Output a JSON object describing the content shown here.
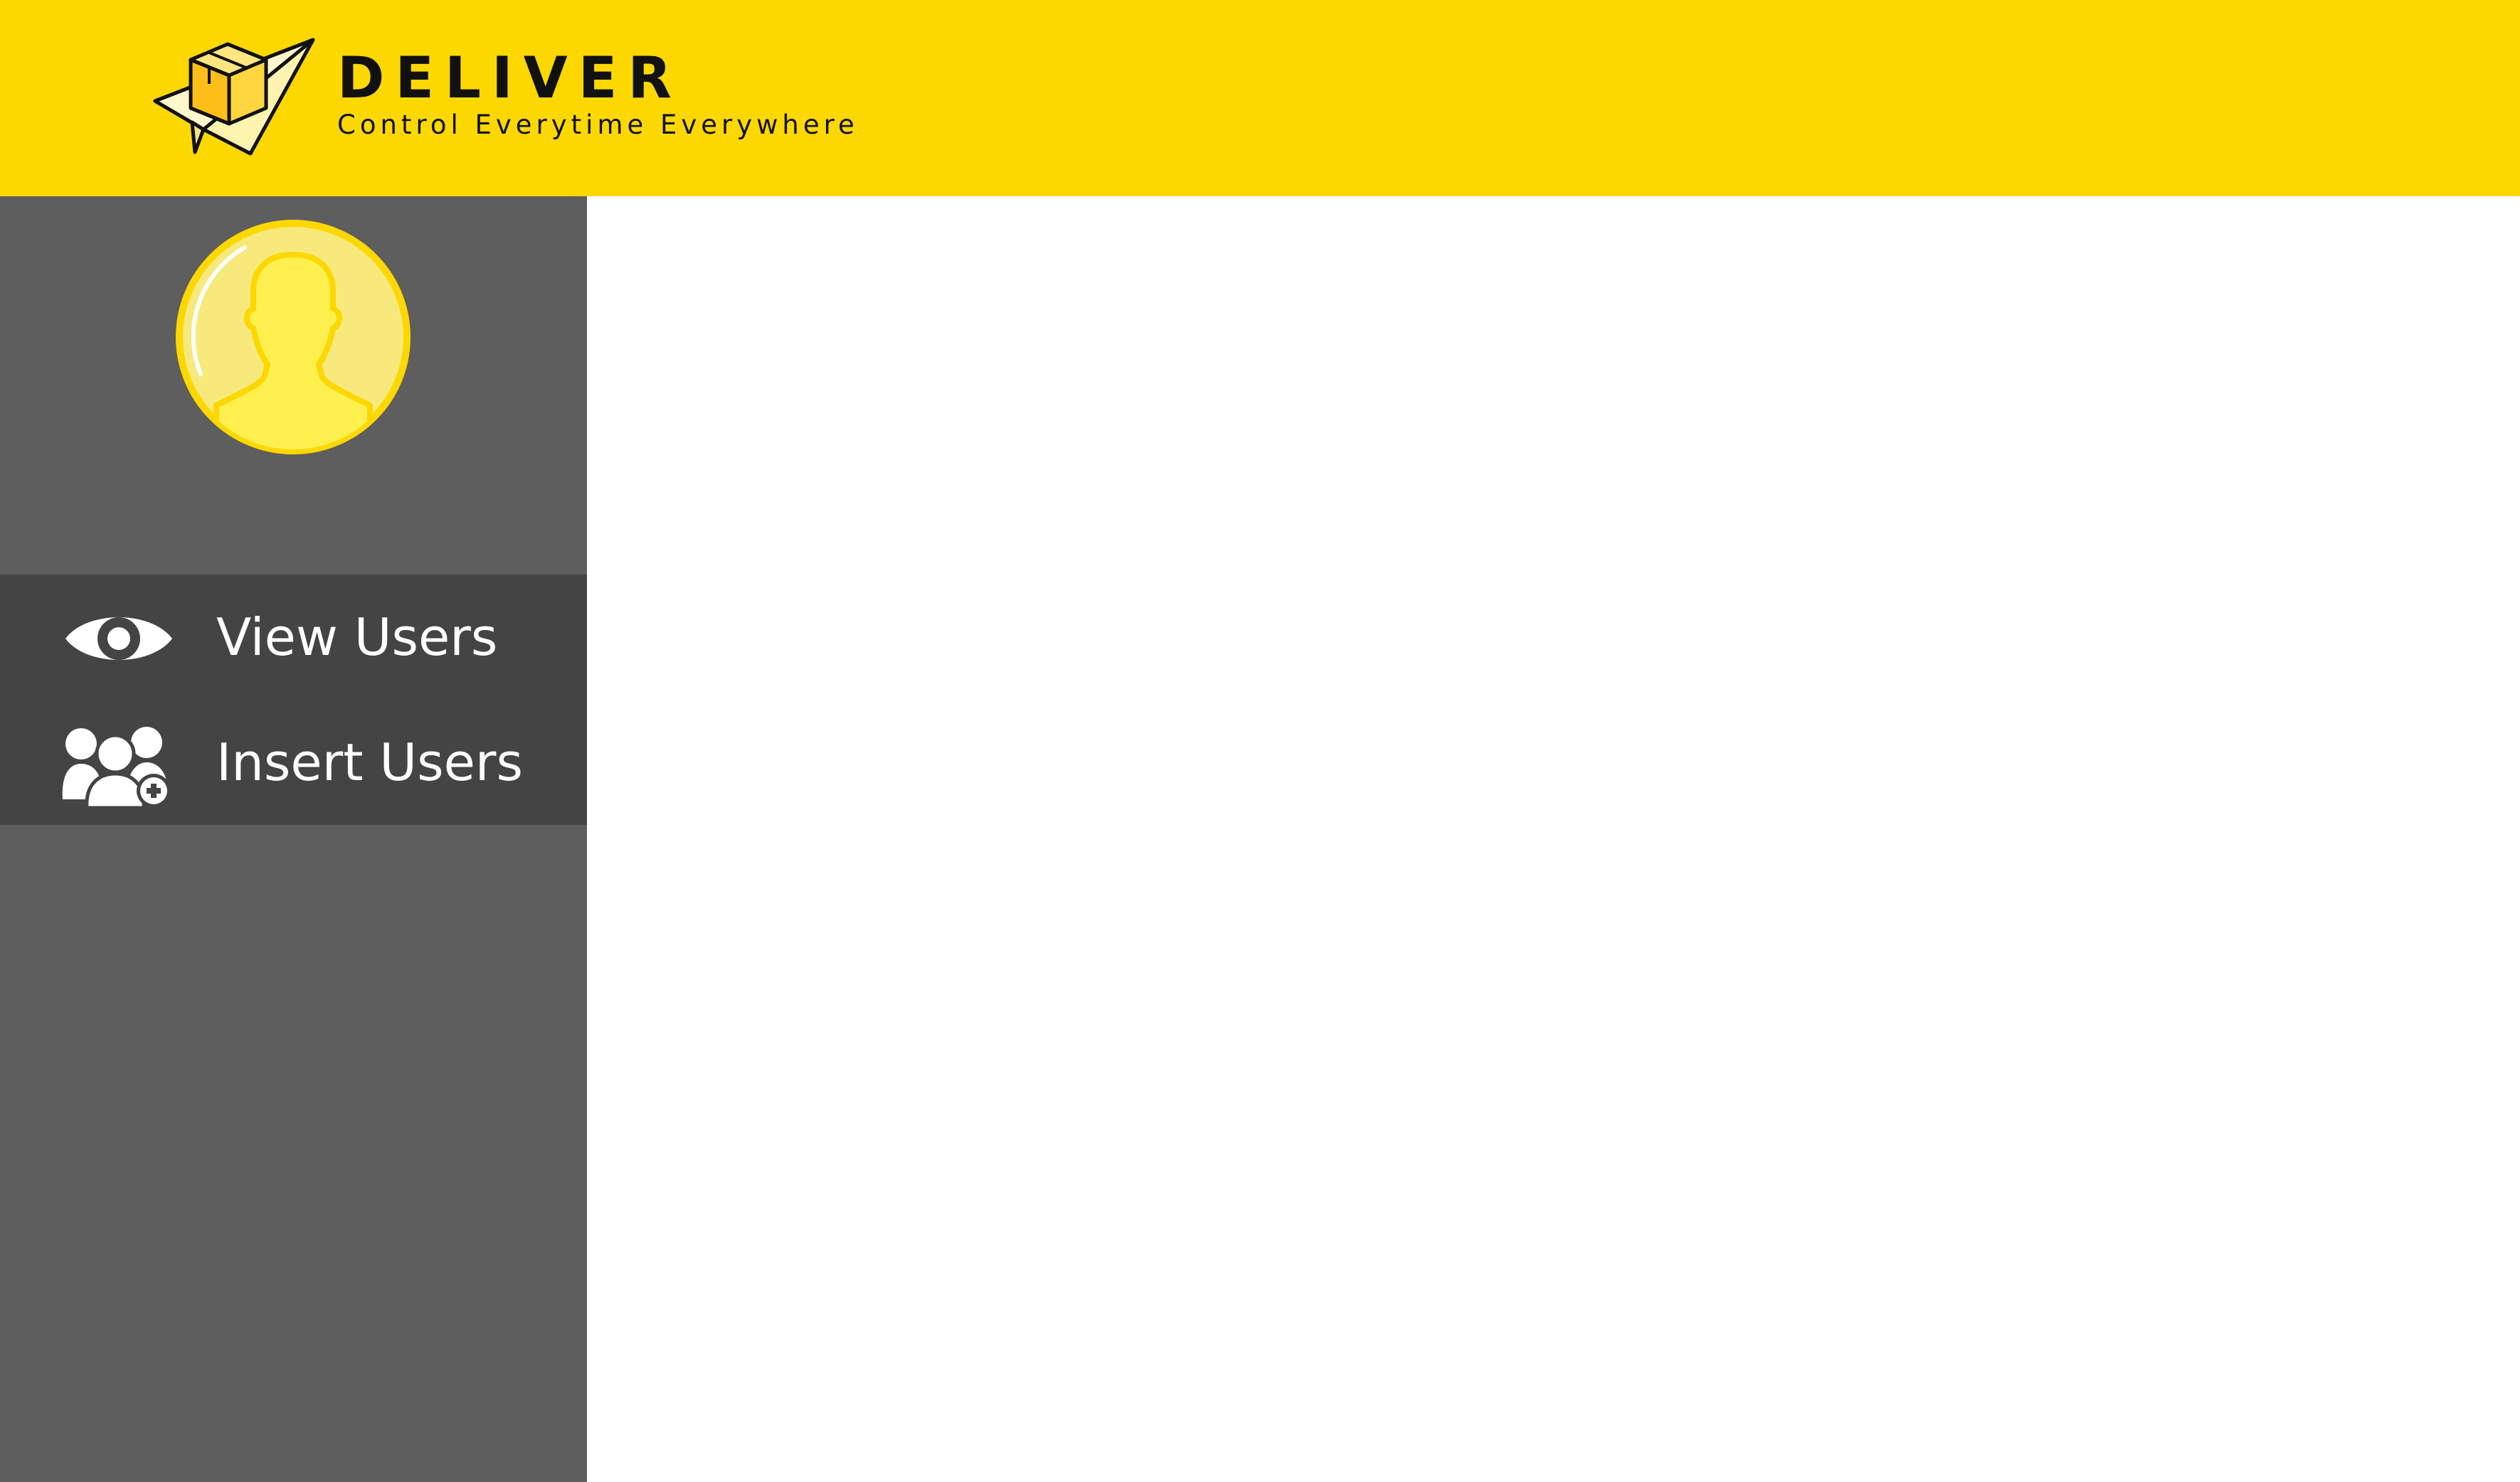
{
  "header": {
    "brand_name": "DELIVER",
    "tagline": "Control Everytime Everywhere",
    "logo_icon": "box-paper-plane-icon",
    "background_color": "#FCD800"
  },
  "sidebar": {
    "background_color": "#5E5E5E",
    "nav_background_color": "#444444",
    "avatar_icon": "user-avatar-icon",
    "items": [
      {
        "label": "View Users",
        "icon": "eye-icon"
      },
      {
        "label": "Insert Users",
        "icon": "add-users-icon"
      }
    ]
  }
}
